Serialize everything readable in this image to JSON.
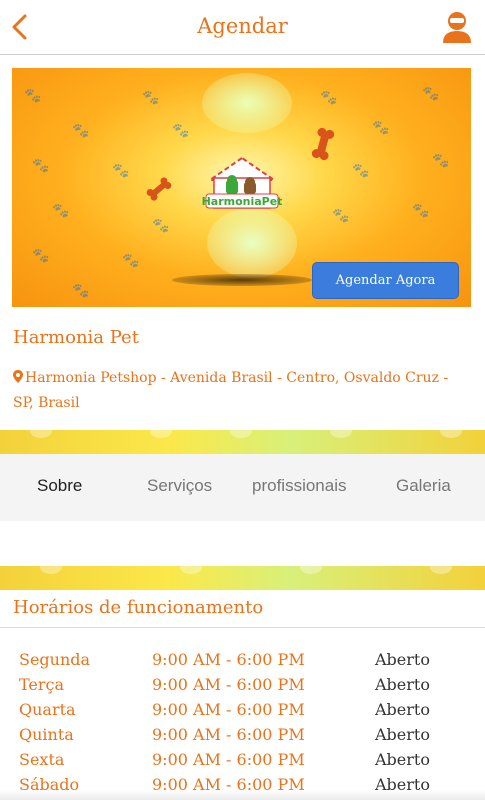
{
  "header": {
    "title": "Agendar",
    "back_icon": "chevron-left-icon",
    "profile_icon": "user-icon",
    "accent_color": "#e8731a"
  },
  "banner": {
    "logo_text": "HarmoniaPet",
    "cta_label": "Agendar Agora",
    "cta_color": "#3b7ddd"
  },
  "store": {
    "name": "Harmonia Pet",
    "address": "Harmonia Petshop - Avenida Brasil - Centro, Osvaldo Cruz - SP, Brasil",
    "pin_icon": "map-marker-icon"
  },
  "tabs": [
    {
      "label": "Sobre",
      "active": true
    },
    {
      "label": "Serviços",
      "active": false
    },
    {
      "label": "profissionais",
      "active": false
    },
    {
      "label": "Galeria",
      "active": false
    }
  ],
  "hours": {
    "title": "Horários de funcionamento",
    "rows": [
      {
        "day": "Segunda",
        "time": "9:00 AM - 6:00 PM",
        "status": "Aberto"
      },
      {
        "day": "Terça",
        "time": "9:00 AM - 6:00 PM",
        "status": "Aberto"
      },
      {
        "day": "Quarta",
        "time": "9:00 AM - 6:00 PM",
        "status": "Aberto"
      },
      {
        "day": "Quinta",
        "time": "9:00 AM - 6:00 PM",
        "status": "Aberto"
      },
      {
        "day": "Sexta",
        "time": "9:00 AM - 6:00 PM",
        "status": "Aberto"
      },
      {
        "day": "Sábado",
        "time": "9:00 AM - 6:00 PM",
        "status": "Aberto"
      }
    ]
  }
}
